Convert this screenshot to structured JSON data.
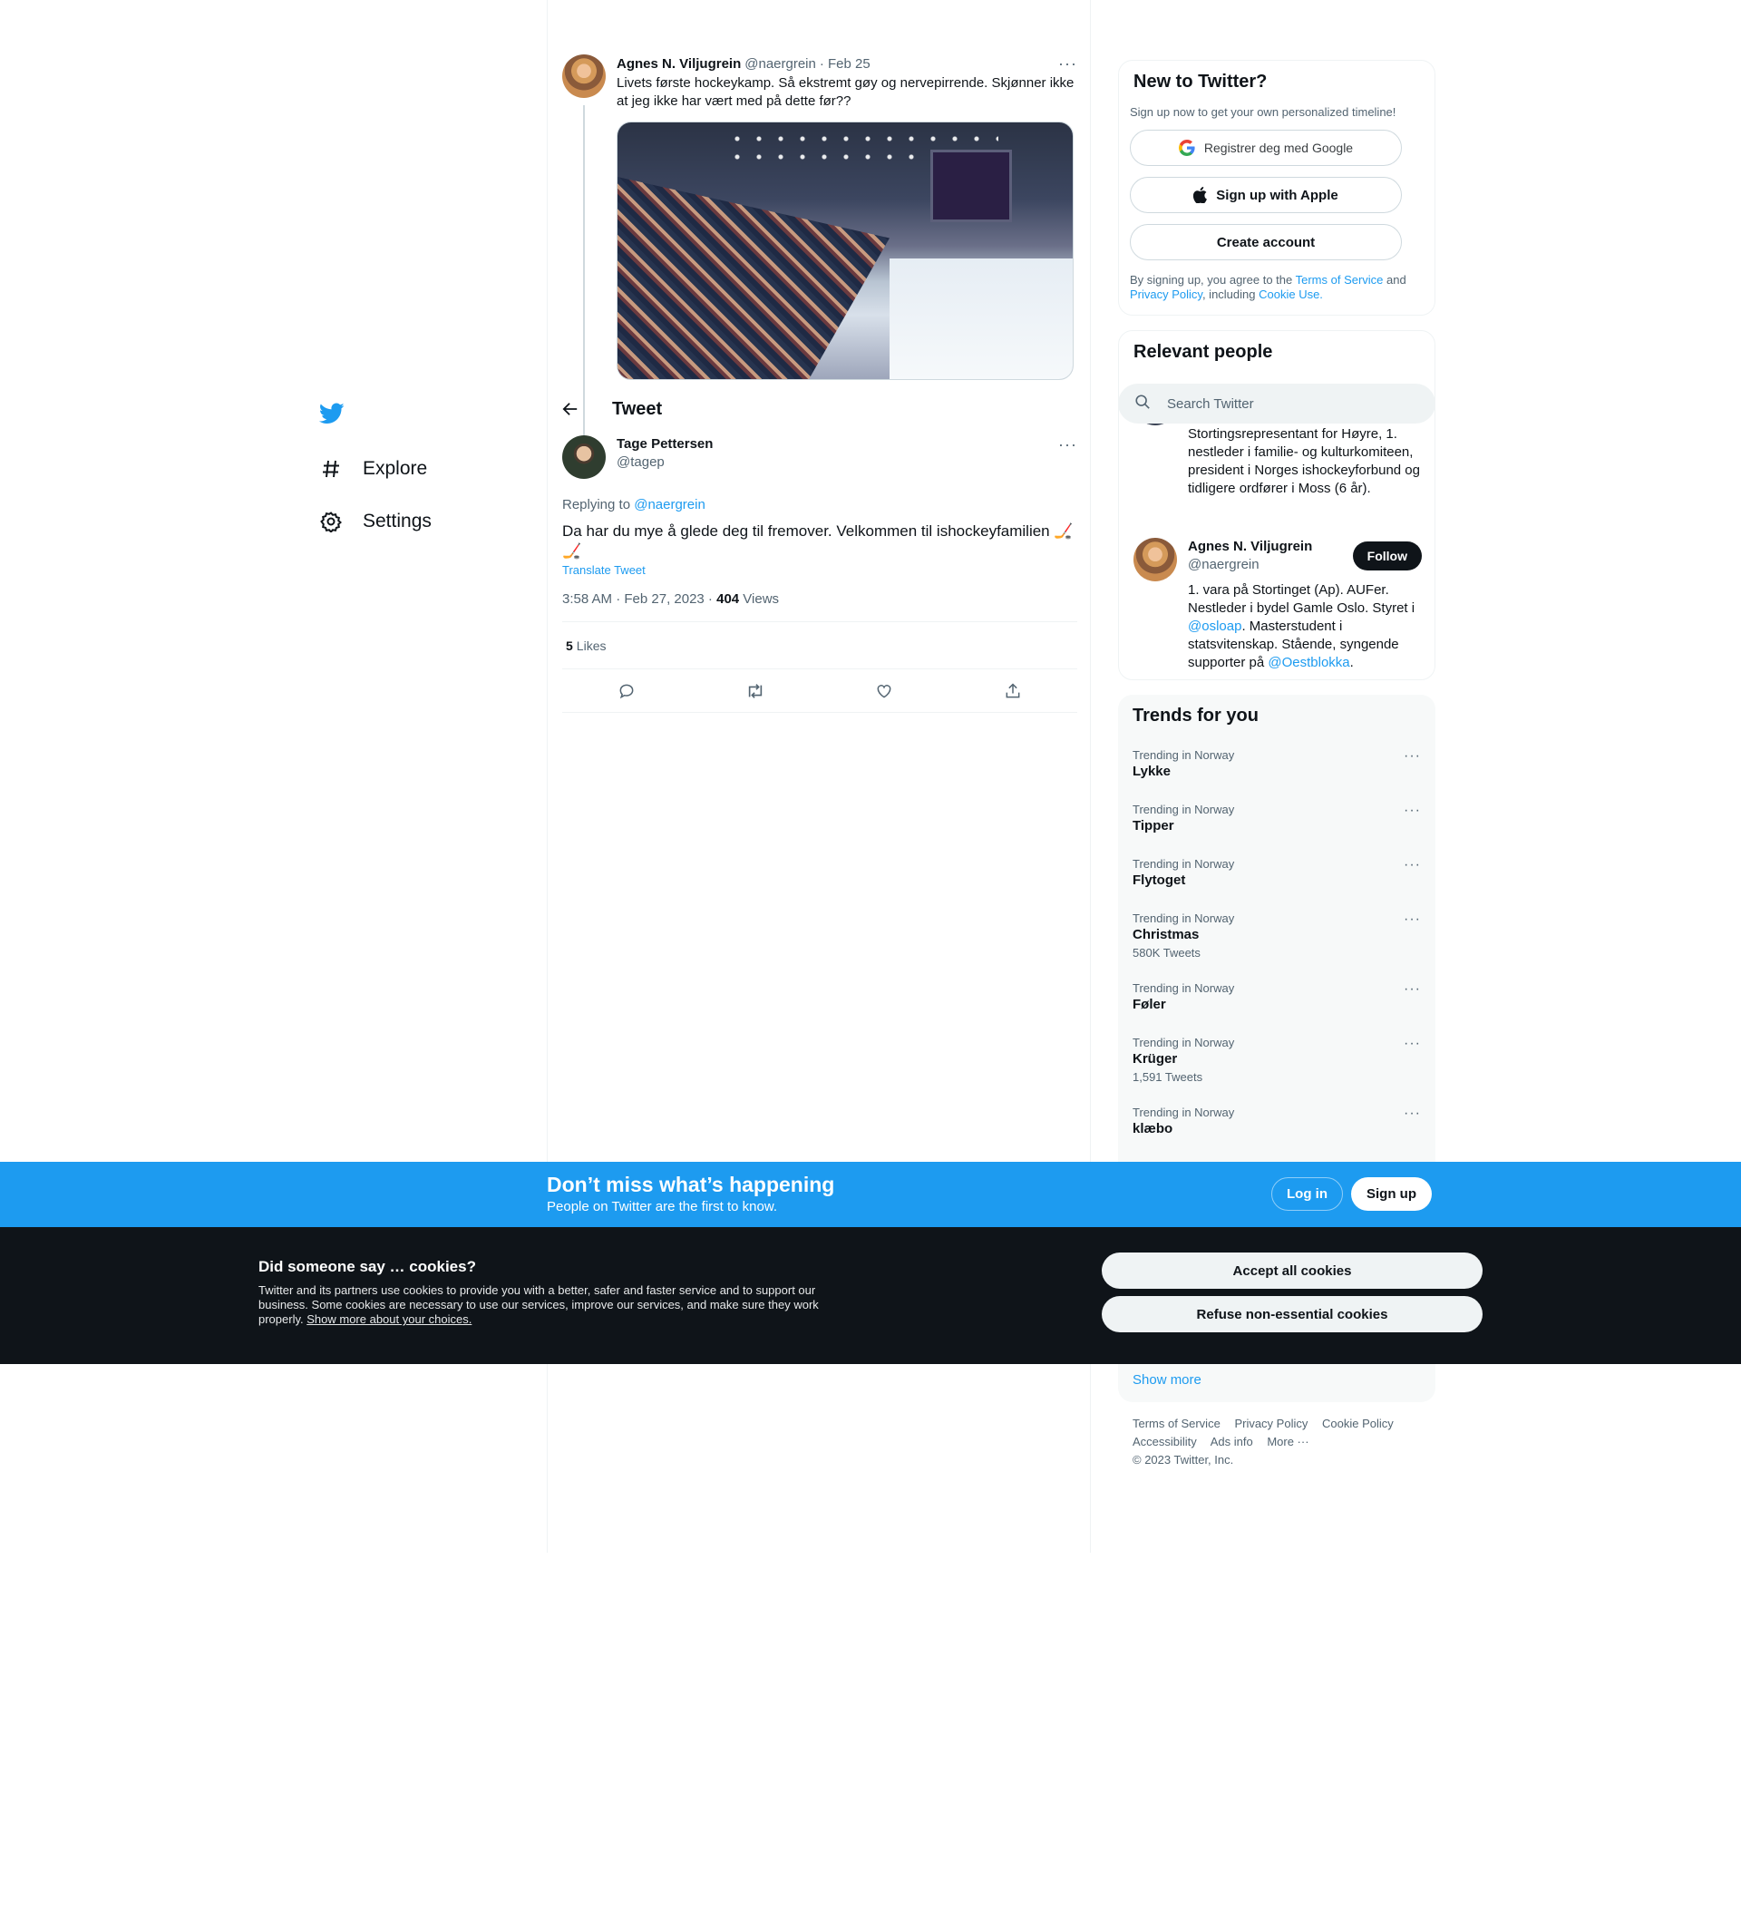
{
  "nav": {
    "explore": "Explore",
    "settings": "Settings"
  },
  "parent_tweet": {
    "name": "Agnes N. Viljugrein",
    "handle": "@naergrein",
    "date": "· Feb 25",
    "text": "Livets første hockeykamp. Så ekstremt gøy og nervepirrende. Skjønner ikke at jeg ikke har vært med på dette før??"
  },
  "header": {
    "title": "Tweet"
  },
  "tweet": {
    "name": "Tage Pettersen",
    "handle": "@tagep",
    "replying_prefix": "Replying to ",
    "replying_to": "@naergrein",
    "text": "Da har du mye å glede deg til fremover. Velkommen til ishockeyfamilien 🏒🏒",
    "translate": "Translate Tweet",
    "timestamp": "3:58 AM · Feb 27, 2023 · ",
    "views_count": "404",
    "views_label": " Views",
    "likes_count": "5",
    "likes_label": "Likes"
  },
  "signup": {
    "title": "New to Twitter?",
    "subtitle": "Sign up now to get your own personalized timeline!",
    "google": "Registrer deg med Google",
    "apple": "Sign up with Apple",
    "create": "Create account",
    "terms_1": "By signing up, you agree to the ",
    "terms_tos": "Terms of Service",
    "terms_2": " and ",
    "terms_privacy": "Privacy Policy",
    "terms_3": ", including ",
    "terms_cookie": "Cookie Use."
  },
  "relevant": {
    "title": "Relevant people",
    "search_placeholder": "Search Twitter",
    "person1_bio": "Stortingsrepresentant for Høyre, 1. nestleder i familie- og kulturkomiteen, president i Norges ishockeyforbund og tidligere ordfører i Moss (6 år).",
    "person2": {
      "name": "Agnes N. Viljugrein",
      "handle": "@naergrein",
      "follow": "Follow",
      "bio_1": "1. vara på Stortinget (Ap). AUFer. Nestleder i bydel Gamle Oslo. Styret i ",
      "bio_link1": "@osloap",
      "bio_2": ". Masterstudent i statsvitenskap. Stående, syngende supporter på ",
      "bio_link2": "@Oestblokka",
      "bio_3": "."
    }
  },
  "trends": {
    "title": "Trends for you",
    "items": [
      {
        "context": "Trending in Norway",
        "name": "Lykke",
        "count": ""
      },
      {
        "context": "Trending in Norway",
        "name": "Tipper",
        "count": ""
      },
      {
        "context": "Trending in Norway",
        "name": "Flytoget",
        "count": ""
      },
      {
        "context": "Trending in Norway",
        "name": "Christmas",
        "count": "580K Tweets"
      },
      {
        "context": "Trending in Norway",
        "name": "Føler",
        "count": ""
      },
      {
        "context": "Trending in Norway",
        "name": "Krüger",
        "count": "1,591 Tweets"
      },
      {
        "context": "Trending in Norway",
        "name": "klæbo",
        "count": ""
      }
    ],
    "show_more": "Show more"
  },
  "footer": {
    "links": [
      "Terms of Service",
      "Privacy Policy",
      "Cookie Policy",
      "Accessibility",
      "Ads info",
      "More ···"
    ],
    "copyright": "© 2023 Twitter, Inc."
  },
  "banner": {
    "title": "Don’t miss what’s happening",
    "subtitle": "People on Twitter are the first to know.",
    "login": "Log in",
    "signup": "Sign up"
  },
  "cookie": {
    "title": "Did someone say … cookies?",
    "text": "Twitter and its partners use cookies to provide you with a better, safer and faster service and to support our business. Some cookies are necessary to use our services, improve our services, and make sure they work properly. ",
    "link": "Show more about your choices.",
    "accept": "Accept all cookies",
    "refuse": "Refuse non-essential cookies"
  },
  "colors": {
    "brand": "#1d9bf0",
    "text": "#0f1419",
    "muted": "#536471",
    "cookie_bg": "#0f1419"
  }
}
